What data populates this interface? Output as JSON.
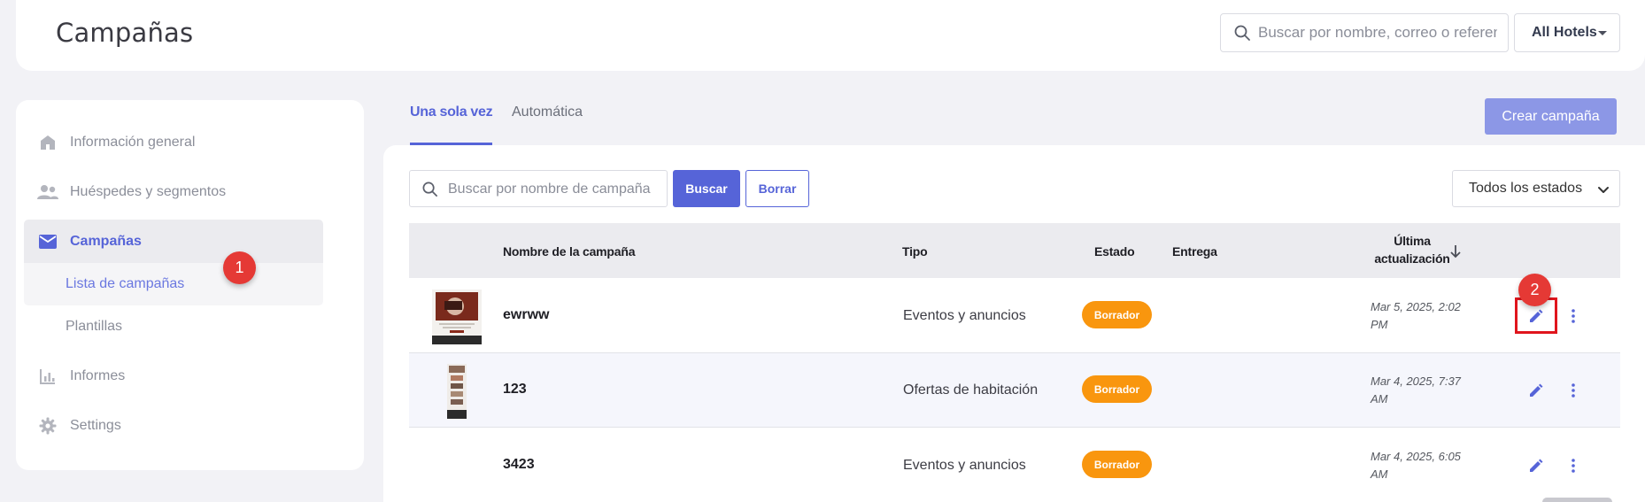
{
  "header": {
    "title": "Campañas",
    "search_placeholder": "Buscar por nombre, correo o referencia",
    "hotel_selector": "All Hotels"
  },
  "sidebar": {
    "items": [
      {
        "label": "Información general",
        "icon": "home-icon"
      },
      {
        "label": "Huéspedes y segmentos",
        "icon": "people-icon"
      },
      {
        "label": "Campañas",
        "icon": "mail-icon",
        "active": true
      },
      {
        "label": "Lista de campañas",
        "sub": true,
        "active": true
      },
      {
        "label": "Plantillas",
        "sub": true
      },
      {
        "label": "Informes",
        "icon": "bar-chart-icon"
      },
      {
        "label": "Settings",
        "icon": "gear-icon"
      }
    ]
  },
  "markers": {
    "first": "1",
    "second": "2"
  },
  "tabs": [
    {
      "label": "Una sola vez",
      "active": true
    },
    {
      "label": "Automática",
      "active": false
    }
  ],
  "actions": {
    "create": "Crear campaña"
  },
  "filters": {
    "search_placeholder": "Buscar por nombre de campaña",
    "search_button": "Buscar",
    "clear_button": "Borrar",
    "status_select": "Todos los estados"
  },
  "table": {
    "columns": {
      "name": "Nombre de la campaña",
      "type": "Tipo",
      "status": "Estado",
      "delivery": "Entrega",
      "updated_line1": "Última",
      "updated_line2": "actualización"
    },
    "rows": [
      {
        "name": "ewrww",
        "type": "Eventos y anuncios",
        "status": "Borrador",
        "date_line1": "Mar 5, 2025, 2:02",
        "date_line2": "PM"
      },
      {
        "name": "123",
        "type": "Ofertas de habitación",
        "status": "Borrador",
        "date_line1": "Mar 4, 2025, 7:37",
        "date_line2": "AM"
      },
      {
        "name": "3423",
        "type": "Eventos y anuncios",
        "status": "Borrador",
        "date_line1": "Mar 4, 2025, 6:05",
        "date_line2": "AM"
      }
    ]
  },
  "colors": {
    "accent": "#5664d8",
    "accent_light": "#8c97e6",
    "draft_badge": "#f9960e",
    "marker": "#e53935"
  }
}
